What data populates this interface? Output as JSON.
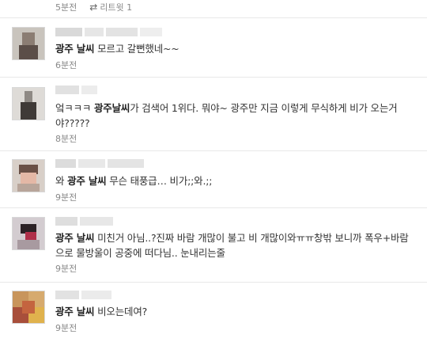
{
  "top": {
    "time": "5분전",
    "retweet_label": "리트윗 1"
  },
  "items": [
    {
      "keyword": "광주 날씨",
      "text_after": " 모르고 갈뻔했네~~",
      "text_before": "",
      "time": "6분전"
    },
    {
      "text_before": "엌ㅋㅋㅋ ",
      "keyword": "광주날씨",
      "text_after": "가 검색어 1위다. 뭐야~ 광주만 지금 이렇게 무식하게 비가 오는거야?????",
      "time": "8분전"
    },
    {
      "text_before": "와 ",
      "keyword": "광주 날씨",
      "text_after": " 무슨 태풍급… 비가;;와.;;",
      "time": "9분전"
    },
    {
      "text_before": "",
      "keyword": "광주 날씨",
      "text_after": " 미친거 아님..?진짜 바람 개많이 불고 비 개많이와ㅠㅠ창밖 보니까 폭우+바람으로 물방울이 공중에 떠다님.. 눈내리는줄",
      "time": "9분전"
    },
    {
      "text_before": "",
      "keyword": "광주 날씨",
      "text_after": " 비오는데여?",
      "time": "9분전"
    }
  ],
  "icons": {
    "retweet": "retweet-icon"
  }
}
